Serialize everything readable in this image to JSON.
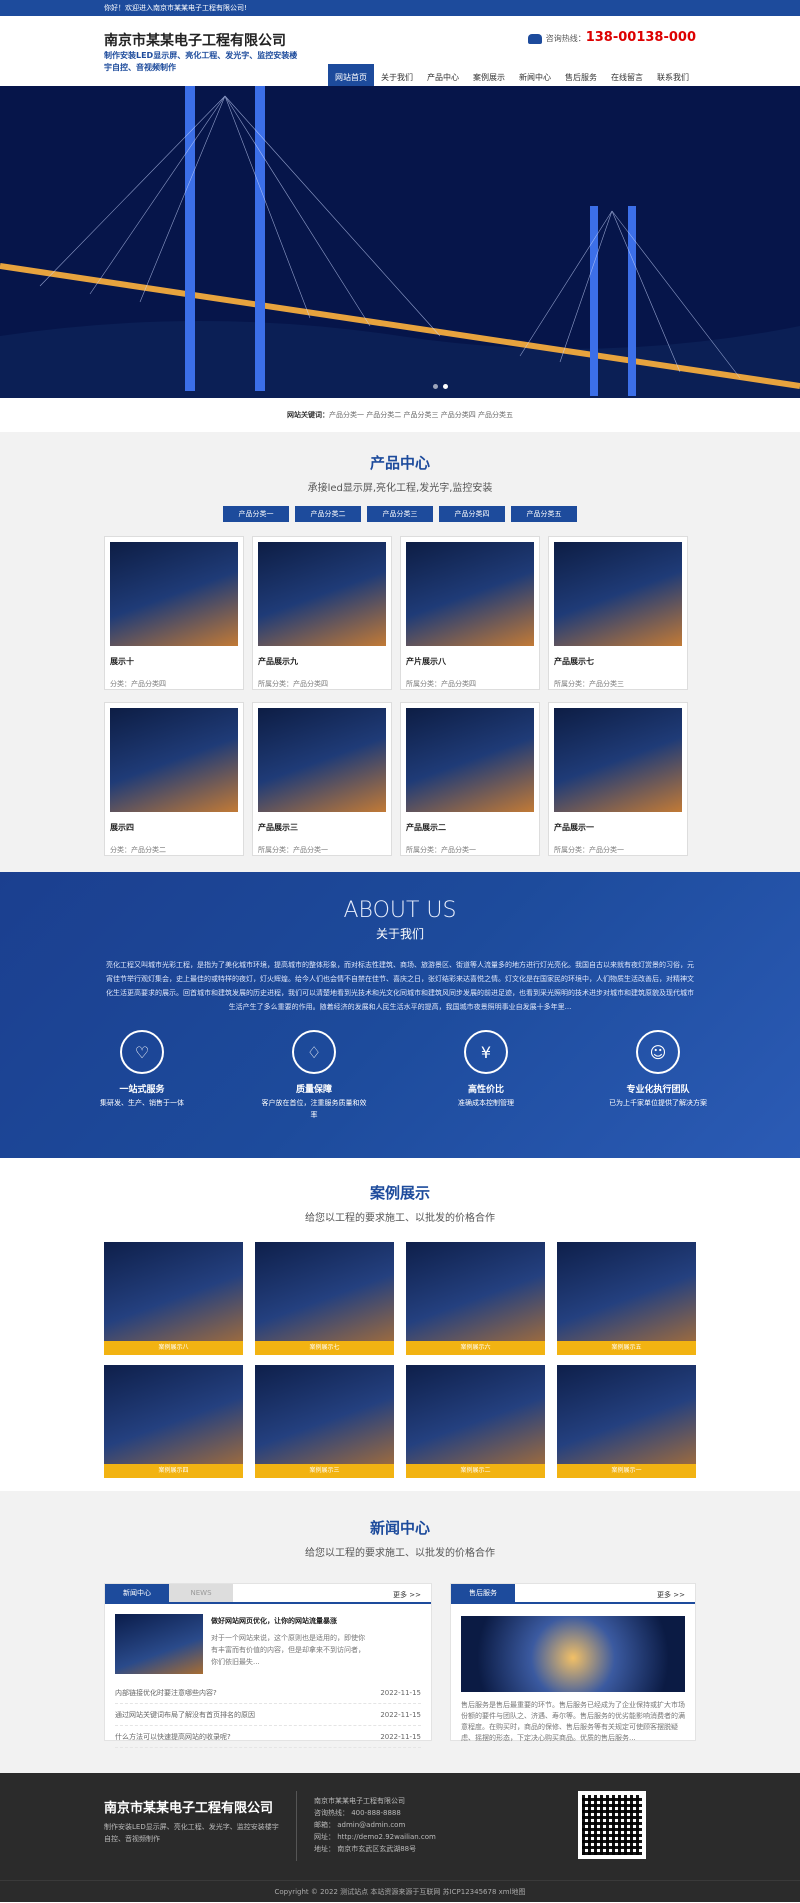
{
  "topbar": {
    "welcome": "你好！欢迎进入南京市某某电子工程有限公司!"
  },
  "header": {
    "company": "南京市某某电子工程有限公司",
    "subtitle": "制作安装LED显示屏、亮化工程、发光字、监控安装楼宇自控、音视频制作",
    "hotline_label": "咨询热线：",
    "hotline_number": "138-00138-000",
    "nav": [
      "网站首页",
      "关于我们",
      "产品中心",
      "案例展示",
      "新闻中心",
      "售后服务",
      "在线留言",
      "联系我们"
    ]
  },
  "keywords": {
    "label": "网站关键词：",
    "value": "产品分类一 产品分类二 产品分类三 产品分类四 产品分类五"
  },
  "products": {
    "title": "产品中心",
    "subtitle": "承接led显示屏,亮化工程,发光字,监控安装",
    "tabs": [
      "产品分类一",
      "产品分类二",
      "产品分类三",
      "产品分类四",
      "产品分类五"
    ],
    "items": [
      {
        "name": "展示十",
        "cat": "分类：产品分类四"
      },
      {
        "name": "产品展示九",
        "cat": "所属分类：产品分类四"
      },
      {
        "name": "产片展示八",
        "cat": "所属分类：产品分类四"
      },
      {
        "name": "产品展示七",
        "cat": "所属分类：产品分类三"
      },
      {
        "name": "展示四",
        "cat": "分类：产品分类二"
      },
      {
        "name": "产品展示三",
        "cat": "所属分类：产品分类一"
      },
      {
        "name": "产品展示二",
        "cat": "所属分类：产品分类一"
      },
      {
        "name": "产品展示一",
        "cat": "所属分类：产品分类一"
      }
    ]
  },
  "about": {
    "title_en": "ABOUT US",
    "title_cn": "关于我们",
    "text": "亮化工程又叫城市光彩工程，是指为了美化城市环境，提高城市的整体形象，而对标志性建筑、商场、旅游景区、街道等人流量多的地方进行灯光亮化。我国自古以来就有夜灯赏景的习俗，元宵佳节举行观灯集会，史上最佳的或特样的夜灯，灯火辉煌。给今人们也会情不自禁在佳节、喜庆之日，张灯结彩来达喜悦之情。灯文化是在国家民的环境中，人们物质生活改善后，对精神文化生活更高要求的展示。回首城市和建筑发展的历史进程，我们可以清楚地看到光技术和光文化同城市和建筑风同步发展的前进足迹，也看到采光照明的技术进步对城市和建筑原貌及现代城市生活产生了多么重要的作用。随着经济的发展和人民生活水平的提高，我国城市夜景照明事业自发展十多年里...",
    "features": [
      {
        "icon": "♡",
        "title": "一站式服务",
        "desc": "集研发、生产、销售于一体"
      },
      {
        "icon": "♢",
        "title": "质量保障",
        "desc": "客户放在首位，注重服务质量和效率"
      },
      {
        "icon": "¥",
        "title": "高性价比",
        "desc": "准确成本控制管理"
      },
      {
        "icon": "☺",
        "title": "专业化执行团队",
        "desc": "已为上千家单位提供了解决方案"
      }
    ]
  },
  "cases": {
    "title": "案例展示",
    "subtitle": "给您以工程的要求施工、以批发的价格合作",
    "items": [
      "案例展示八",
      "案例展示七",
      "案例展示六",
      "案例展示五",
      "案例展示四",
      "案例展示三",
      "案例展示二",
      "案例展示一"
    ]
  },
  "news": {
    "title": "新闻中心",
    "subtitle": "给您以工程的要求施工、以批发的价格合作",
    "tabs": [
      "新闻中心",
      "NEWS"
    ],
    "more": "更多 >>",
    "featured_title": "做好网站网页优化，让你的网站流量暴涨",
    "featured_desc": "对于一个网站来说，这个原则也是适用的，即使你有丰富而有价值的内容，但是却拿来不到访问者，你们依旧最失...",
    "list": [
      {
        "title": "内部链接优化时要注意哪些内容?",
        "date": "2022-11-15"
      },
      {
        "title": "通过网站关键词布局了解没有首页排名的原因",
        "date": "2022-11-15"
      },
      {
        "title": "什么方法可以快速提高网站的收录呢?",
        "date": "2022-11-15"
      }
    ],
    "service_tab": "售后服务",
    "service_more": "更多 >>",
    "service_text": "售后服务是售后最重要的环节。售后服务已经成为了企业保持或扩大市场份额的要件与团队之、济遇、寿尔等。售后服务的优劣能影响消费者的满意程度。在购买时，商品的保修、售后服务等有关规定可使顾客摆脱疑虑、摇摆的形态，下定决心购买商品。优质的售后服务..."
  },
  "footer": {
    "company": "南京市某某电子工程有限公司",
    "subtitle": "制作安装LED显示屏、亮化工程、发光字、监控安装楼宇自控、音视频制作",
    "info": [
      "南京市某某电子工程有限公司",
      "咨询热线：  400-888-8888",
      "邮箱：  admin@admin.com",
      "网址：  http://demo2.92wailian.com",
      "地址：  南京市玄武区玄武湖88号"
    ],
    "copyright": "Copyright © 2022 测试站点 本站资源来源于互联网  苏ICP12345678  xml地图"
  },
  "colors": {
    "brand": "#1d4b9c",
    "accent_red": "#dd0000",
    "case_caption": "#f2b312"
  }
}
